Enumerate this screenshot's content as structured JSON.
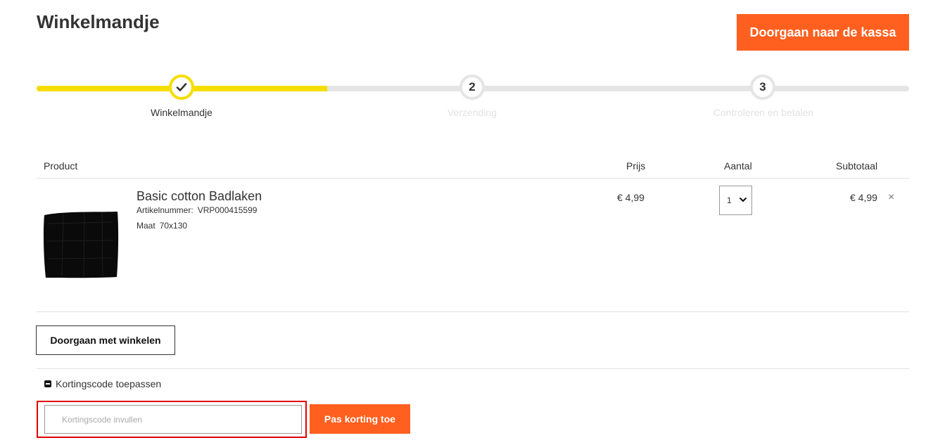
{
  "page": {
    "title": "Winkelmandje"
  },
  "header": {
    "checkout_label": "Doorgaan naar de kassa"
  },
  "steps": [
    {
      "number": "",
      "label": "Winkelmandje",
      "state": "done",
      "icon": "check-icon"
    },
    {
      "number": "2",
      "label": "Verzending",
      "state": "todo"
    },
    {
      "number": "3",
      "label": "Controleren en betalen",
      "state": "todo"
    }
  ],
  "progress": {
    "fraction": 0.333
  },
  "table": {
    "headers": {
      "product": "Product",
      "price": "Prijs",
      "quantity": "Aantal",
      "subtotal": "Subtotaal"
    }
  },
  "item": {
    "name": "Basic cotton Badlaken",
    "sku_label": "Artikelnummer:",
    "sku": "VRP000415599",
    "size_label": "Maat",
    "size": "70x130",
    "price": "€ 4,99",
    "quantity": "1",
    "subtotal": "€ 4,99",
    "remove_icon": "close-icon",
    "remove_glyph": "×"
  },
  "actions": {
    "continue_shopping": "Doorgaan met winkelen"
  },
  "coupon": {
    "toggle_label": "Kortingscode toepassen",
    "placeholder": "Kortingscode invullen",
    "apply_label": "Pas korting toe"
  },
  "colors": {
    "accent": "#ff5f1f",
    "progress": "#f6dd00",
    "highlight": "#e00000"
  }
}
